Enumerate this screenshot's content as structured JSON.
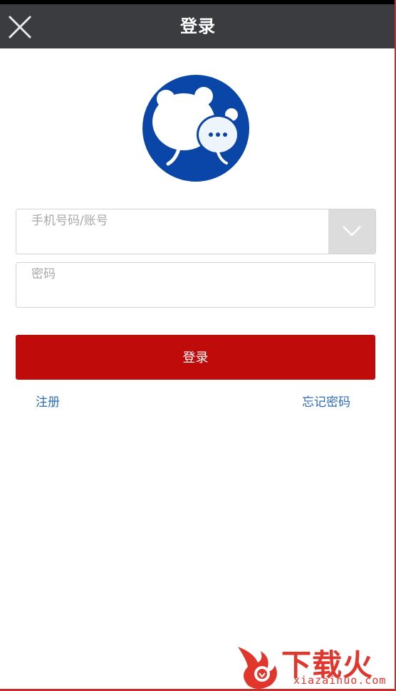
{
  "header": {
    "title": "登录",
    "close_icon": "close-icon"
  },
  "logo": {
    "icon": "chat-bubble-bears-logo",
    "color": "#0a45a8"
  },
  "form": {
    "account": {
      "placeholder": "手机号码/账号",
      "value": "",
      "dropdown_icon": "chevron-down-icon"
    },
    "password": {
      "placeholder": "密码",
      "value": ""
    },
    "login_label": "登录"
  },
  "links": {
    "register": "注册",
    "forgot_password": "忘记密码"
  },
  "watermark": {
    "brand": "下载火",
    "site": "xiazaihuo.com"
  },
  "colors": {
    "header_bg": "#3a3c3f",
    "primary": "#c00b0b",
    "link": "#2d6dbd"
  }
}
